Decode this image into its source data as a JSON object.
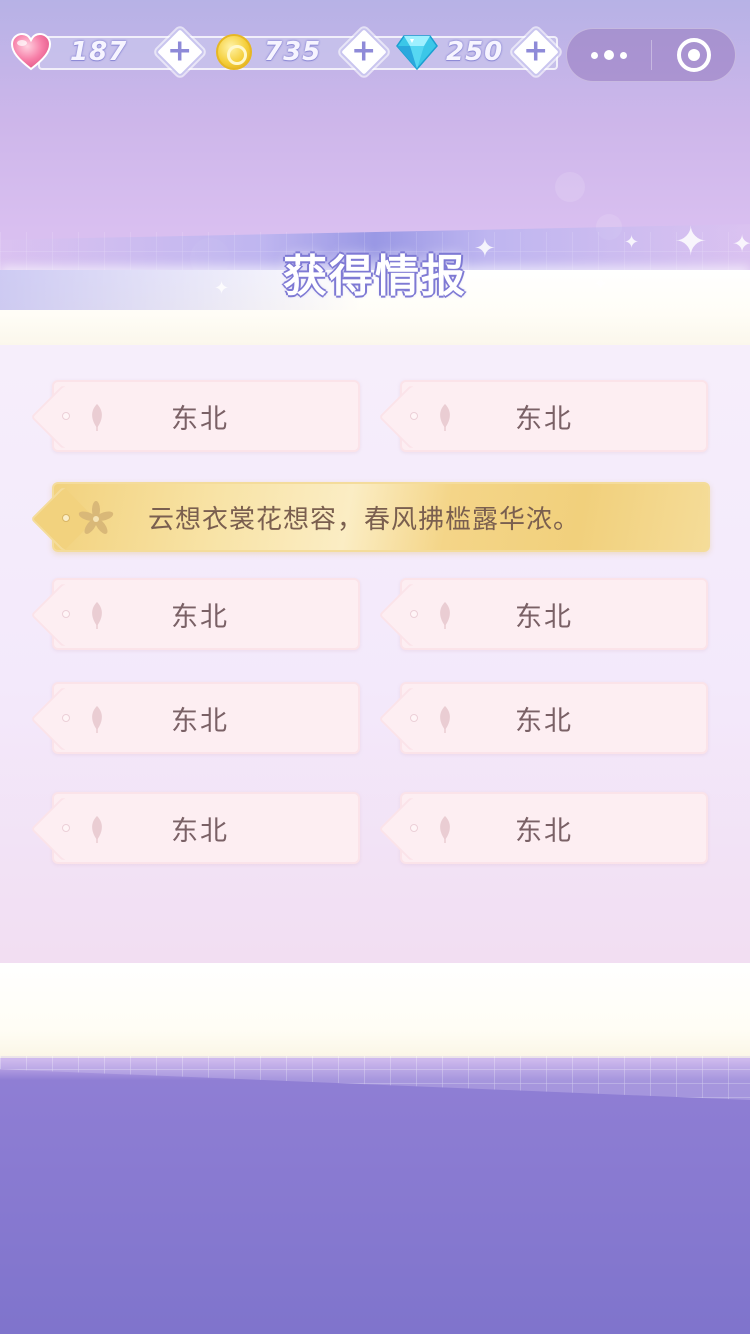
{
  "hud": {
    "hearts": "187",
    "coins": "735",
    "diamonds": "250"
  },
  "title": "获得情报",
  "clue": {
    "text": "云想衣裳花想容，春风拂槛露华浓。"
  },
  "options": [
    {
      "label": "东北"
    },
    {
      "label": "东北"
    },
    {
      "label": "东北"
    },
    {
      "label": "东北"
    },
    {
      "label": "东北"
    },
    {
      "label": "东北"
    },
    {
      "label": "东北"
    },
    {
      "label": "东北"
    }
  ],
  "colors": {
    "accent": "#8e8ad8",
    "option_bg": "#fdeef2",
    "clue_gold": "#f2d27e",
    "text": "#7a6166"
  },
  "icons": [
    "heart-icon",
    "coin-icon",
    "diamond-icon",
    "plus-icon",
    "more-icon",
    "close-circle-icon",
    "leaf-icon",
    "flower-icon"
  ]
}
